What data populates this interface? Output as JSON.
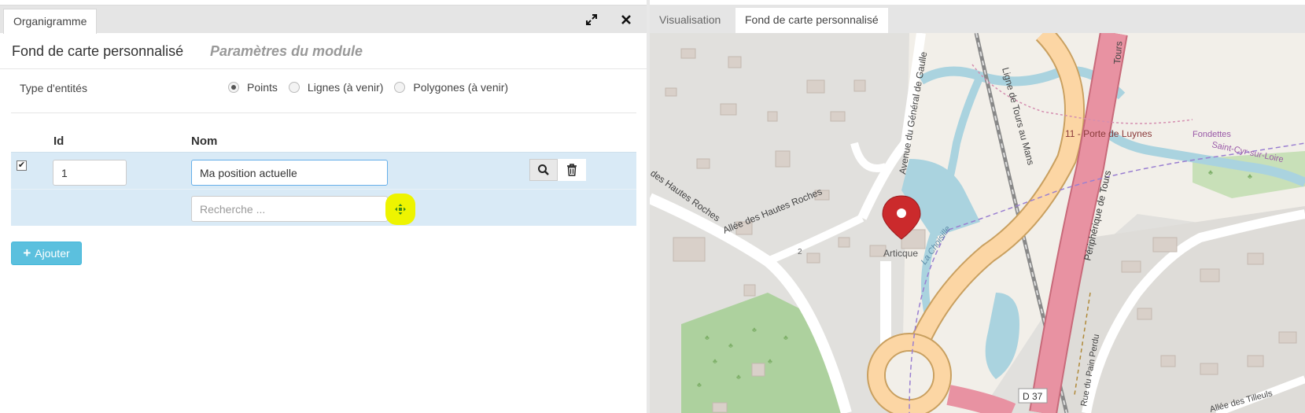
{
  "left_panel": {
    "tab_label": "Organigramme",
    "title": "Fond de carte personnalisé",
    "subtitle": "Paramètres du module",
    "expand_icon": "expand-icon",
    "close_icon": "close-icon",
    "entity_type": {
      "label": "Type d'entités",
      "options": [
        {
          "label": "Points",
          "checked": true
        },
        {
          "label": "Lignes (à venir)",
          "checked": false
        },
        {
          "label": "Polygones (à venir)",
          "checked": false
        }
      ]
    },
    "table": {
      "headers": {
        "id": "Id",
        "name": "Nom"
      },
      "row": {
        "checked": true,
        "id": "1",
        "name": "Ma position actuelle",
        "search_placeholder": "Recherche ..."
      }
    },
    "add_button": "Ajouter"
  },
  "right_panel": {
    "tabs": [
      {
        "label": "Visualisation",
        "active": false
      },
      {
        "label": "Fond de carte personnalisé",
        "active": true
      }
    ],
    "map": {
      "labels": {
        "avenue": "Avenue du Général de Gaulle",
        "ligne": "Ligne de Tours au Mans",
        "porte": "11 - Porte de Luynes",
        "peripherique": "Périphérique de Tours",
        "tours": "Tours",
        "fondettes": "Fondettes",
        "saint_cyr": "Saint-Cyr-sur-Loire",
        "hautes_roches_1": "des Hautes Roches",
        "hautes_roches_2": "Allée des Hautes Roches",
        "choisille": "La Choisille",
        "marker": "Articque",
        "house_number": "2",
        "pain_perdu": "Rue du Pain Perdu",
        "d37": "D 37",
        "tilleuls": "Allée des Tilleuls"
      },
      "colors": {
        "background": "#e1e0dd",
        "water": "#aad3df",
        "forest": "#add19e",
        "motorway": "#e892a2",
        "primary": "#fcd6a4",
        "marker": "#cb2a2c"
      }
    }
  }
}
